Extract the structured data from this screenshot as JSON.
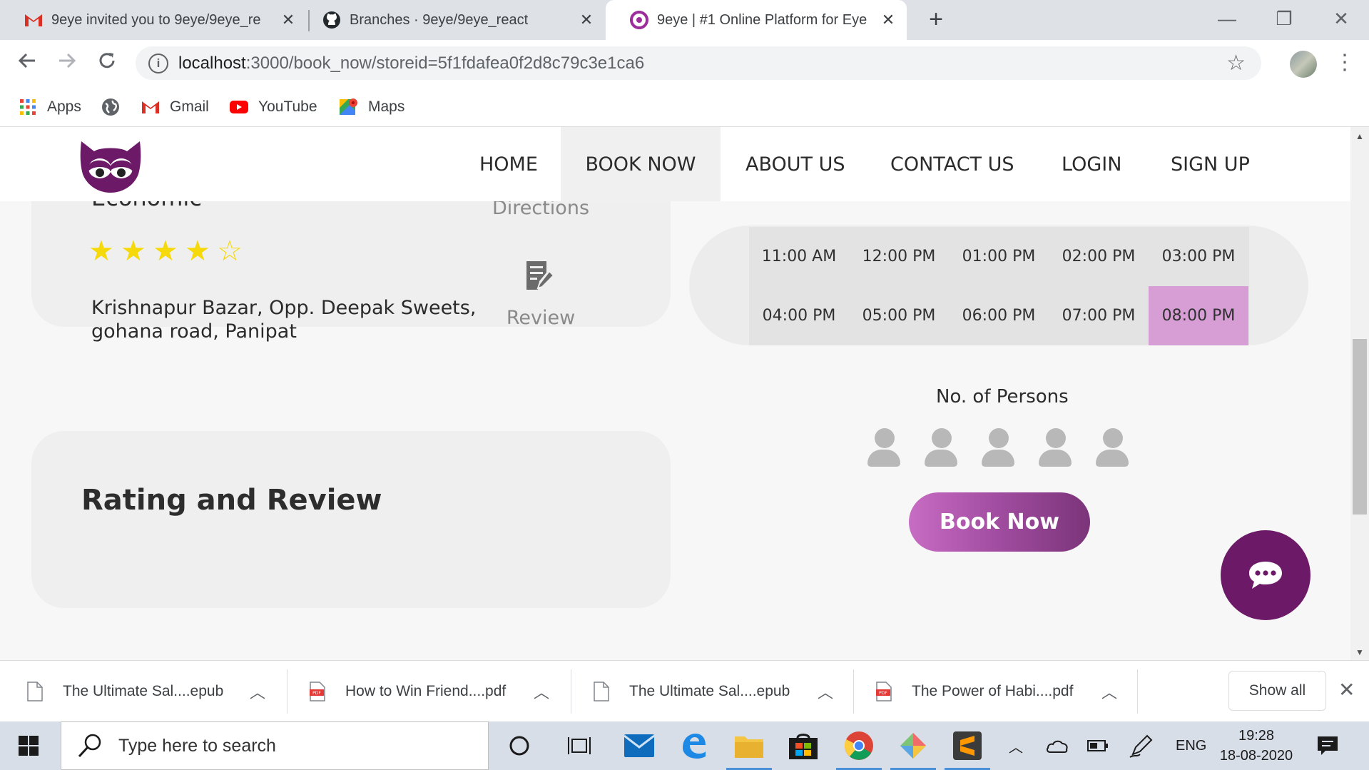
{
  "browser": {
    "tabs": [
      {
        "title": "9eye invited you to 9eye/9eye_re",
        "icon": "gmail-icon"
      },
      {
        "title": "Branches · 9eye/9eye_react",
        "icon": "github-icon"
      },
      {
        "title": "9eye | #1 Online Platform for Eye",
        "icon": "9eye-icon",
        "active": true
      }
    ],
    "new_tab": "+",
    "url_host": "localhost",
    "url_path": ":3000/book_now/storeid=5f1fdafea0f2d8c79c3e1ca6",
    "bookmarks": [
      {
        "label": "Apps",
        "icon": "apps-grid-icon"
      },
      {
        "label": "",
        "icon": "globe-icon"
      },
      {
        "label": "Gmail",
        "icon": "gmail-icon"
      },
      {
        "label": "YouTube",
        "icon": "youtube-icon"
      },
      {
        "label": "Maps",
        "icon": "maps-icon"
      }
    ]
  },
  "site": {
    "nav": [
      {
        "label": "HOME"
      },
      {
        "label": "BOOK NOW",
        "active": true
      },
      {
        "label": "ABOUT US"
      },
      {
        "label": "CONTACT US"
      },
      {
        "label": "LOGIN"
      },
      {
        "label": "SIGN UP"
      }
    ],
    "store": {
      "name": "Economic",
      "rating_filled": 4,
      "rating_max": 5,
      "address": "Krishnapur Bazar, Opp. Deepak Sweets, gohana road, Panipat",
      "directions_label": "Directions",
      "review_label": "Review"
    },
    "rating_review_title": "Rating and Review",
    "time_slots": [
      "11:00 AM",
      "12:00 PM",
      "01:00 PM",
      "02:00 PM",
      "03:00 PM",
      "04:00 PM",
      "05:00 PM",
      "06:00 PM",
      "07:00 PM",
      "08:00 PM"
    ],
    "selected_slot": "08:00 PM",
    "persons_label": "No. of Persons",
    "persons_count": 5,
    "book_button": "Book Now",
    "colors": {
      "brand_purple": "#6c1a68",
      "selected_slot": "#d79ed6",
      "star": "#f5d90a"
    }
  },
  "downloads": {
    "items": [
      {
        "name": "The Ultimate Sal....epub",
        "type": "file"
      },
      {
        "name": "How to Win Friend....pdf",
        "type": "pdf"
      },
      {
        "name": "The Ultimate Sal....epub",
        "type": "file"
      },
      {
        "name": "The Power of Habi....pdf",
        "type": "pdf"
      }
    ],
    "show_all": "Show all"
  },
  "taskbar": {
    "search_placeholder": "Type here to search",
    "language": "ENG",
    "time": "19:28",
    "date": "18-08-2020"
  }
}
